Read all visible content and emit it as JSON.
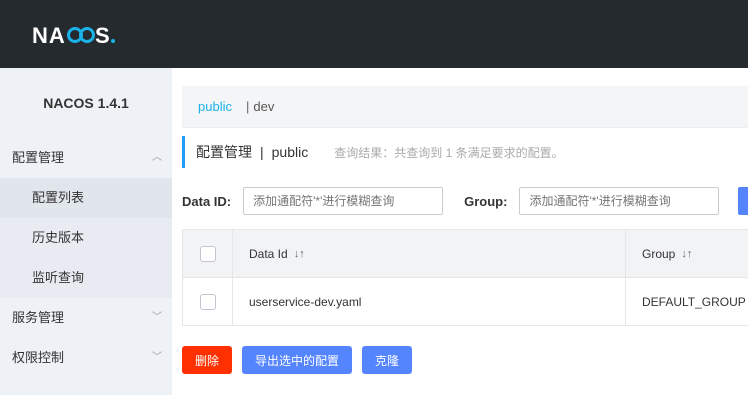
{
  "brand": {
    "logo_text": "NACOS."
  },
  "sidebar": {
    "version": "NACOS 1.4.1",
    "groups": [
      {
        "label": "配置管理",
        "items": [
          "配置列表",
          "历史版本",
          "监听查询"
        ]
      },
      {
        "label": "服务管理"
      },
      {
        "label": "权限控制"
      }
    ]
  },
  "breadcrumb": {
    "namespace": "public",
    "separator": "|",
    "sub": "dev"
  },
  "page": {
    "title": "配置管理",
    "title_sep": "|",
    "title_ns": "public",
    "result_hint": "查询结果：共查询到 1 条满足要求的配置。"
  },
  "filters": {
    "data_id_label": "Data ID:",
    "data_id_placeholder": "添加通配符'*'进行模糊查询",
    "group_label": "Group:",
    "group_placeholder": "添加通配符'*'进行模糊查询"
  },
  "table": {
    "columns": {
      "data_id": "Data Id",
      "group": "Group"
    },
    "rows": [
      {
        "data_id": "userservice-dev.yaml",
        "group": "DEFAULT_GROUP"
      }
    ]
  },
  "actions": {
    "delete": "删除",
    "export": "导出选中的配置",
    "clone": "克隆"
  },
  "colors": {
    "accent": "#209bfa",
    "primary": "#5584ff",
    "danger": "#ff3000",
    "topbar": "#252a2f"
  }
}
